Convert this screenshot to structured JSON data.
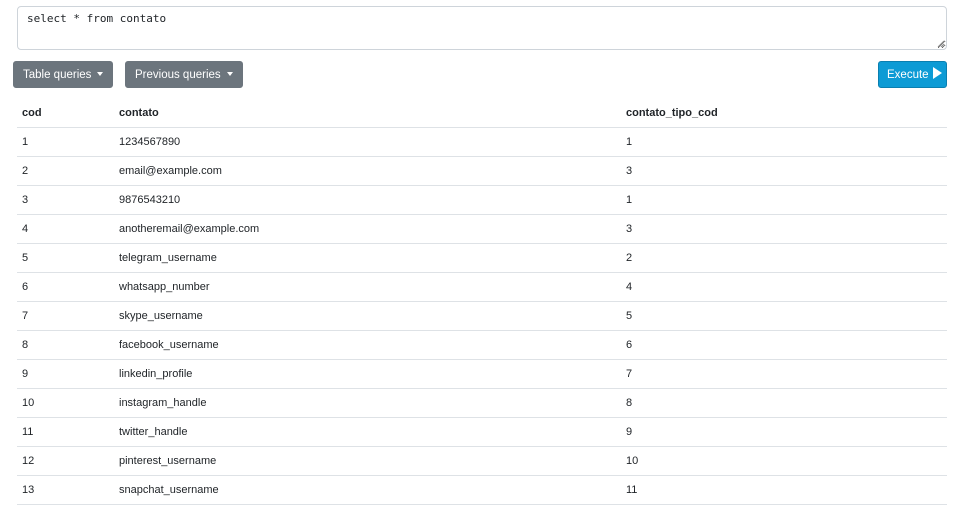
{
  "query": {
    "text": "select * from contato"
  },
  "toolbar": {
    "table_queries_label": "Table queries",
    "previous_queries_label": "Previous queries",
    "execute_label": "Execute"
  },
  "results": {
    "columns": [
      "cod",
      "contato",
      "contato_tipo_cod"
    ],
    "rows": [
      [
        "1",
        "1234567890",
        "1"
      ],
      [
        "2",
        "email@example.com",
        "3"
      ],
      [
        "3",
        "9876543210",
        "1"
      ],
      [
        "4",
        "anotheremail@example.com",
        "3"
      ],
      [
        "5",
        "telegram_username",
        "2"
      ],
      [
        "6",
        "whatsapp_number",
        "4"
      ],
      [
        "7",
        "skype_username",
        "5"
      ],
      [
        "8",
        "facebook_username",
        "6"
      ],
      [
        "9",
        "linkedin_profile",
        "7"
      ],
      [
        "10",
        "instagram_handle",
        "8"
      ],
      [
        "11",
        "twitter_handle",
        "9"
      ],
      [
        "12",
        "pinterest_username",
        "10"
      ],
      [
        "13",
        "snapchat_username",
        "11"
      ]
    ]
  },
  "colors": {
    "secondary_button": "#6c757d",
    "primary_button": "#0d9bd5",
    "row_border": "#dee2e6"
  },
  "icons": {
    "dropdown": "caret-down-icon",
    "execute": "play-icon"
  }
}
